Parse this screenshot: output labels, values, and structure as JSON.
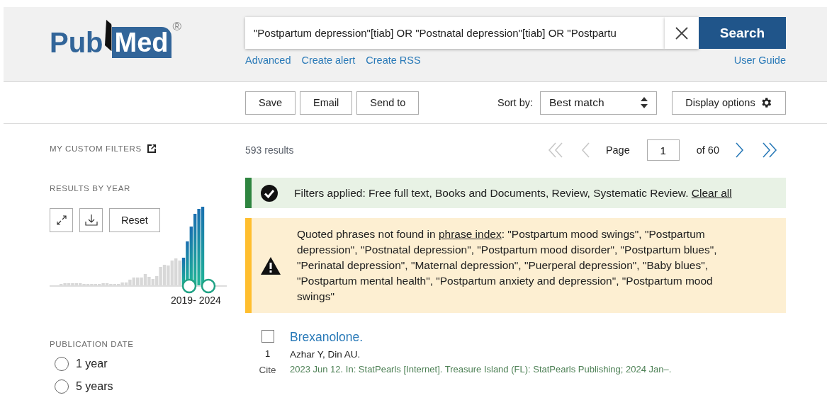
{
  "logo": {
    "part_1": "Pub",
    "part_2": "Med",
    "mark": "®"
  },
  "search": {
    "value": "\"Postpartum depression\"[tiab] OR \"Postnatal depression\"[tiab] OR \"Postpartu",
    "button": "Search"
  },
  "search_links": [
    "Advanced",
    "Create alert",
    "Create RSS"
  ],
  "user_guide": "User Guide",
  "actions": [
    "Save",
    "Email",
    "Send to"
  ],
  "sort": {
    "label": "Sort by:",
    "value": "Best match"
  },
  "display_options": "Display options",
  "sidebar": {
    "custom_filters": "MY CUSTOM FILTERS",
    "results_by_year": "RESULTS BY YEAR",
    "reset": "Reset",
    "range": "2019- 2024",
    "publication_date": "PUBLICATION DATE",
    "date_options": [
      {
        "label": "1 year",
        "selected": false
      },
      {
        "label": "5 years",
        "selected": false
      }
    ]
  },
  "results_count": "593 results",
  "pagination": {
    "first_disabled": true,
    "prev_disabled": true,
    "label": "Page",
    "page": "1",
    "of": "of 60",
    "next_disabled": false,
    "last_disabled": false
  },
  "filters_notice": {
    "text": "Filters applied: Free full text, Books and Documents, Review, Systematic Review.",
    "link": "Clear all"
  },
  "warning": {
    "before": "Quoted phrases not found in",
    "link": "phrase index",
    "after": ": \"Postpartum mood swings\", \"Postpartum depression\", \"Postnatal depression\", \"Postpartum mood disorder\", \"Postpartum blues\", \"Perinatal depression\", \"Maternal depression\", \"Puerperal depression\", \"Baby blues\", \"Postpartum mental health\", \"Postpartum anxiety and depression\", \"Postpartum mood swings\""
  },
  "results": [
    {
      "checked": false,
      "number": "1",
      "cite": "Cite",
      "title": "Brexanolone.",
      "authors": "Azhar Y, Din AU.",
      "citation": "2023 Jun 12. In: StatPearls [Internet]. Treasure Island (FL): StatPearls Publishing; 2024 Jan–."
    }
  ]
}
